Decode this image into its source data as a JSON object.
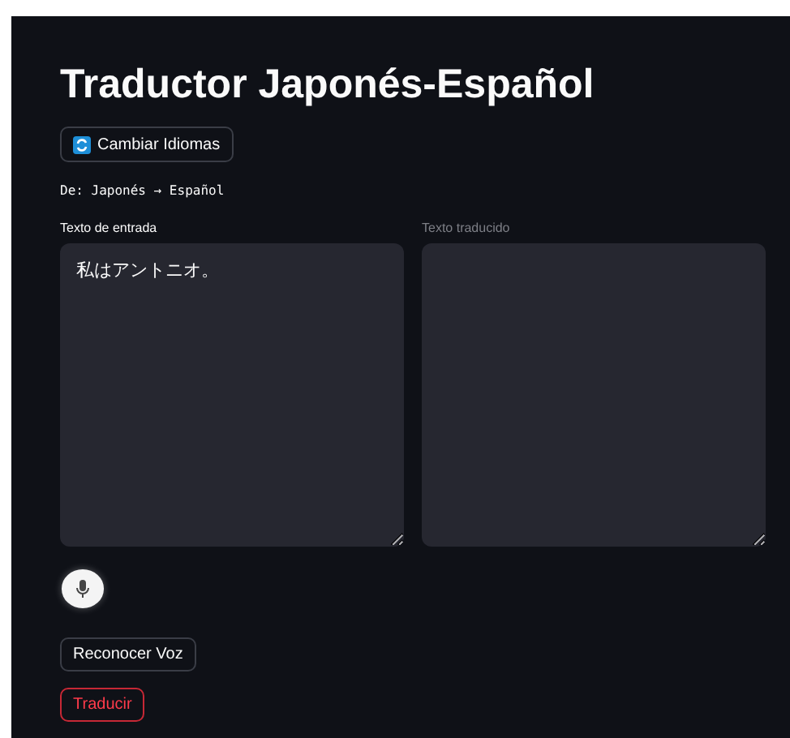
{
  "title": "Traductor Japonés-Español",
  "swap_button": {
    "label": "Cambiar Idiomas"
  },
  "direction": "De: Japonés → Español",
  "fields": [
    {
      "label": "Texto de entrada",
      "value": "私はアントニオ。",
      "disabled": false
    },
    {
      "label": "Texto traducido",
      "disabled": true
    }
  ],
  "buttons": [
    {
      "label": "Reconocer Voz",
      "focused": false
    },
    {
      "label": "Traducir",
      "focused": true
    }
  ]
}
